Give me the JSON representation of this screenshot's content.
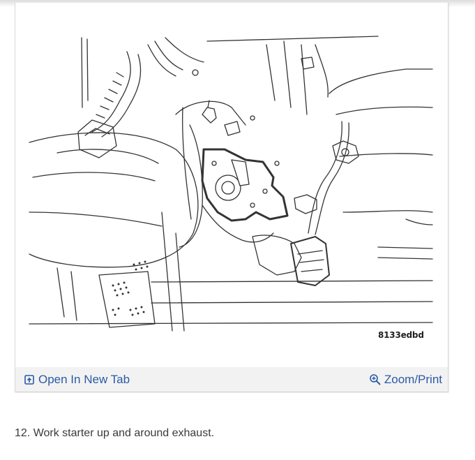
{
  "figure": {
    "code": "8133edbd",
    "open_tab_label": "Open In New Tab",
    "zoom_print_label": "Zoom/Print",
    "open_tab_icon": "open-in-new-tab-icon",
    "zoom_icon": "zoom-in-icon",
    "link_color": "#2a5aa5",
    "toolbar_color": "#f2f2f2"
  },
  "step": {
    "text": "12. Work starter up and around exhaust."
  }
}
